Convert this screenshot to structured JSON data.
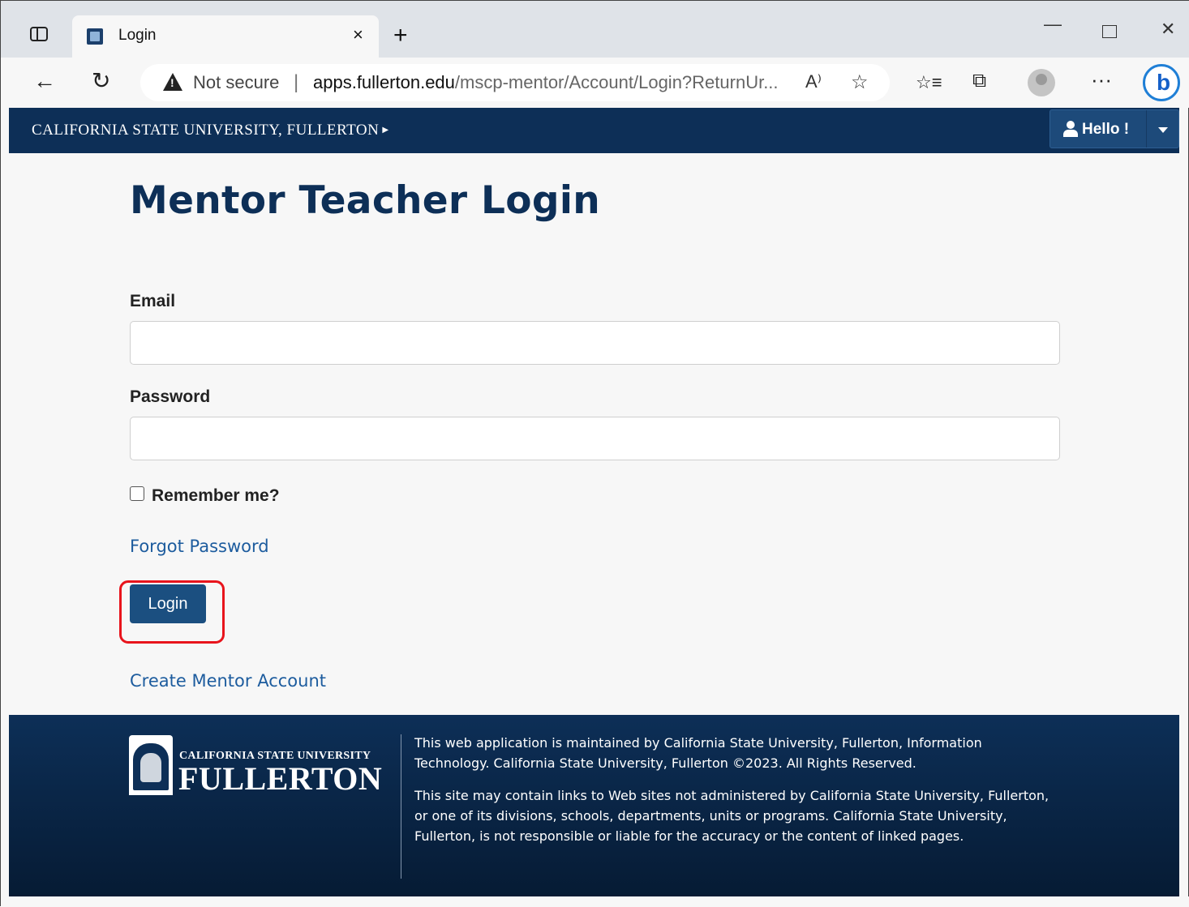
{
  "browser": {
    "tab_title": "Login",
    "tab_close": "×",
    "new_tab": "+",
    "window_controls": {
      "minimize": "—",
      "close": "✕"
    },
    "address": {
      "security_label": "Not secure",
      "separator": "|",
      "url_host": "apps.fullerton.edu",
      "url_path": "/mscp-mentor/Account/Login?ReturnUr...",
      "read_aloud": "A⁾"
    },
    "icons": {
      "back": "←",
      "refresh": "↻",
      "favorite_add": "☆",
      "favorites": "☆≡",
      "collections": "⧉",
      "more": "···"
    }
  },
  "site_header": {
    "university_link": "CALIFORNIA STATE UNIVERSITY, FULLERTON",
    "university_arrow": "▶",
    "user_menu_label": "Hello !"
  },
  "login": {
    "title": "Mentor Teacher Login",
    "email_label": "Email",
    "email_value": "",
    "password_label": "Password",
    "password_value": "",
    "remember_label": "Remember me?",
    "remember_checked": false,
    "forgot_link": "Forgot Password",
    "login_button": "Login",
    "create_link": "Create Mentor Account"
  },
  "footer": {
    "logo_small": "CALIFORNIA STATE UNIVERSITY",
    "logo_big": "FULLERTON",
    "text1": "This web application is maintained by California State University, Fullerton, Information Technology. California State University, Fullerton ©2023. All Rights Reserved.",
    "text2": "This site may contain links to Web sites not administered by California State University, Fullerton, or one of its divisions, schools, departments, units or programs. California State University, Fullerton, is not responsible or liable for the accuracy or the content of linked pages."
  },
  "colors": {
    "brand_navy": "#0d2f57",
    "link_blue": "#1d5c9e",
    "button_blue": "#1b4f80",
    "highlight_red": "#e8141c"
  }
}
